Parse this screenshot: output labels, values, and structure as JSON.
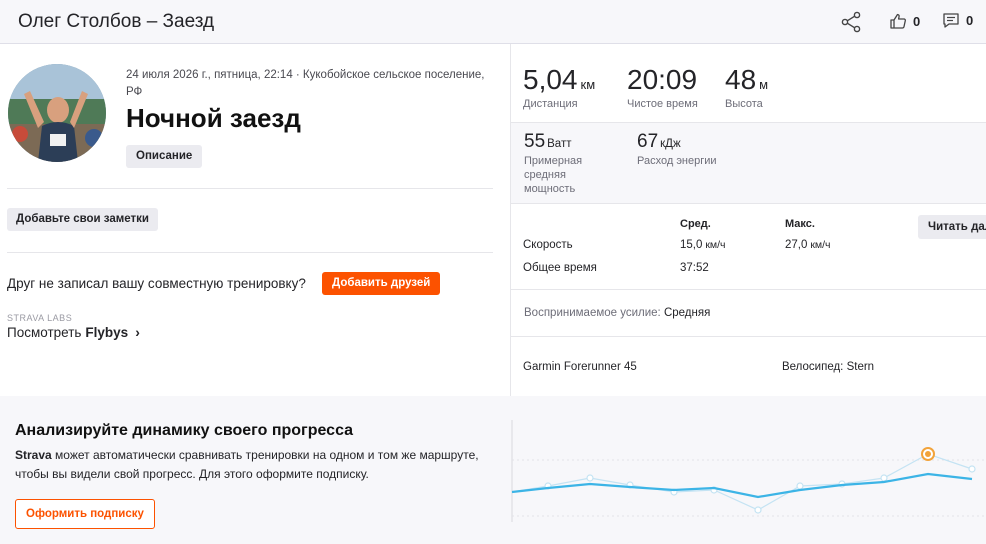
{
  "header": {
    "title": "Олег Столбов – Заезд",
    "kudos_count": "0",
    "comments_count": "0",
    "icons": [
      "share-icon",
      "thumbs-up-icon",
      "comment-icon"
    ]
  },
  "activity": {
    "meta": "24 июля 2026 г., пятница, 22:14 · Кукобойское сельское поселение, РФ",
    "name": "Ночной заезд",
    "description_button": "Описание",
    "notes_button": "Добавьте свои заметки",
    "friend_text": "Друг не записал вашу совместную тренировку?",
    "add_friends_button": "Добавить друзей",
    "labs_label": "STRAVA LABS",
    "flybys_prefix": "Посмотреть",
    "flybys_bold": "Flybys"
  },
  "stats": {
    "distance": {
      "value": "5,04",
      "unit": "км",
      "label": "Дистанция"
    },
    "moving_time": {
      "value": "20:09",
      "label": "Чистое время"
    },
    "elevation": {
      "value": "48",
      "unit": "м",
      "label": "Высота"
    },
    "power": {
      "value": "55",
      "unit": "Ватт",
      "label": "Примерная средняя мощность"
    },
    "energy": {
      "value": "67",
      "unit": "кДж",
      "label": "Расход энергии"
    }
  },
  "table": {
    "avg_header": "Сред.",
    "max_header": "Макс.",
    "speed_label": "Скорость",
    "speed_avg": "15,0",
    "speed_max": "27,0",
    "speed_unit": "км/ч",
    "total_time_label": "Общее время",
    "total_time_avg": "37:52",
    "read_more_button": "Читать далее"
  },
  "effort": {
    "label": "Воспринимаемое усилие:",
    "value": "Средняя"
  },
  "gear": {
    "device": "Garmin Forerunner 45",
    "bike_label": "Велосипед:",
    "bike_value": "Stern"
  },
  "promo": {
    "title": "Анализируйте динамику своего прогресса",
    "text_bold": "Strava",
    "text": "может автоматически сравнивать тренировки на одном и том же маршруте, чтобы вы видели свой прогресс. Для этого оформите подписку.",
    "button": "Оформить подписку"
  },
  "colors": {
    "accent": "#fc5200",
    "spark_line": "#3cb4e6",
    "spark_faint": "#c4e3f3",
    "highlight": "#f2a33a"
  }
}
